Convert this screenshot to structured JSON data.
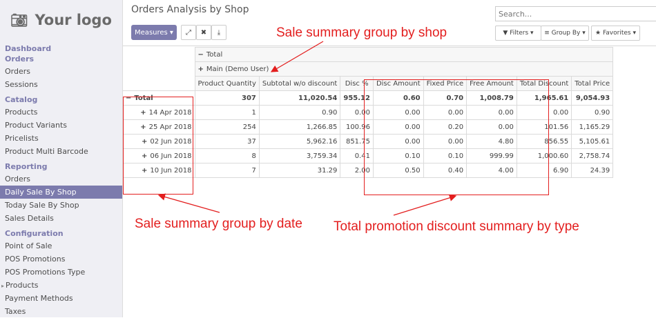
{
  "logo": {
    "text": "Your logo",
    "icon": "camera-icon"
  },
  "sidebar": {
    "dashboard": "Dashboard",
    "sections": [
      {
        "label": "Orders",
        "items": [
          "Orders",
          "Sessions"
        ]
      },
      {
        "label": "Catalog",
        "items": [
          "Products",
          "Product Variants",
          "Pricelists",
          "Product Multi Barcode"
        ]
      },
      {
        "label": "Reporting",
        "items": [
          "Orders",
          "Daily Sale By Shop",
          "Today Sale By Shop",
          "Sales Details"
        ]
      },
      {
        "label": "Configuration",
        "items": [
          "Point of Sale",
          "POS Promotions",
          "POS Promotions Type",
          "Products",
          "Payment Methods",
          "Taxes"
        ]
      }
    ],
    "active_item": "Daily Sale By Shop"
  },
  "header": {
    "title": "Orders Analysis by Shop",
    "measures_label": "Measures ▾",
    "search_placeholder": "Search...",
    "filters_label": "▼ Filters ▾",
    "groupby_label": "≡ Group By ▾",
    "favorites_label": "★ Favorites ▾"
  },
  "pivot": {
    "col_total": "Total",
    "col_group": "Main (Demo User)",
    "measures": [
      "Product Quantity",
      "Subtotal w/o discount",
      "Disc %",
      "Disc Amount",
      "Fixed Price",
      "Free Amount",
      "Total Discount",
      "Total Price"
    ],
    "rows": [
      {
        "label": "Total",
        "values": [
          "307",
          "11,020.54",
          "955.12",
          "0.60",
          "0.70",
          "1,008.79",
          "1,965.61",
          "9,054.93"
        ]
      },
      {
        "label": "14 Apr 2018",
        "values": [
          "1",
          "0.90",
          "0.00",
          "0.00",
          "0.00",
          "0.00",
          "0.00",
          "0.90"
        ]
      },
      {
        "label": "25 Apr 2018",
        "values": [
          "254",
          "1,266.85",
          "100.96",
          "0.00",
          "0.20",
          "0.00",
          "101.56",
          "1,165.29"
        ]
      },
      {
        "label": "02 Jun 2018",
        "values": [
          "37",
          "5,962.16",
          "851.75",
          "0.00",
          "0.00",
          "4.80",
          "856.55",
          "5,105.61"
        ]
      },
      {
        "label": "06 Jun 2018",
        "values": [
          "8",
          "3,759.34",
          "0.41",
          "0.10",
          "0.10",
          "999.99",
          "1,000.60",
          "2,758.74"
        ]
      },
      {
        "label": "10 Jun 2018",
        "values": [
          "7",
          "31.29",
          "2.00",
          "0.50",
          "0.40",
          "4.00",
          "6.90",
          "24.39"
        ]
      }
    ]
  },
  "annotations": {
    "shop": "Sale summary group by shop",
    "date": "Sale summary group by date",
    "promo": "Total promotion discount summary by type"
  },
  "colors": {
    "accent": "#7c7bad",
    "annotation": "#e31e1e"
  }
}
